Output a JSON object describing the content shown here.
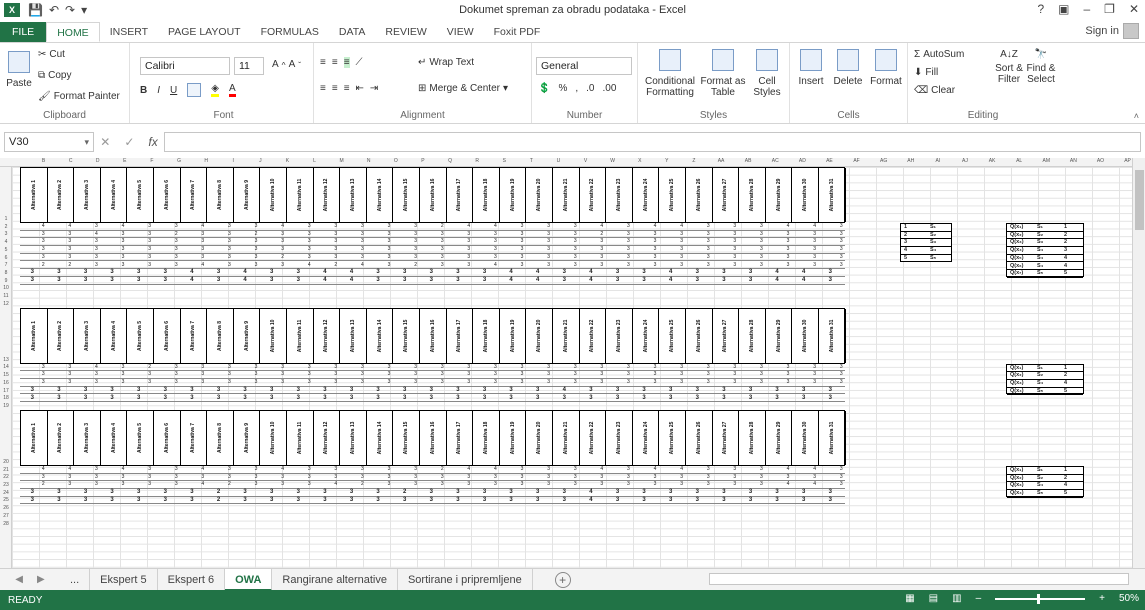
{
  "app": {
    "title": "Dokumet spreman za obradu podataka - Excel",
    "logo": "X",
    "help": "?",
    "sign_in": "Sign in",
    "brand_color": "#217346"
  },
  "ribbon_tabs": [
    "FILE",
    "HOME",
    "INSERT",
    "PAGE LAYOUT",
    "FORMULAS",
    "DATA",
    "REVIEW",
    "VIEW",
    "Foxit PDF"
  ],
  "active_tab": "HOME",
  "ribbon": {
    "clipboard": {
      "paste": "Paste",
      "cut": "Cut",
      "copy": "Copy",
      "format_painter": "Format Painter",
      "label": "Clipboard"
    },
    "font": {
      "family": "Calibri",
      "size": "11",
      "bold": "B",
      "italic": "I",
      "underline": "U",
      "label": "Font"
    },
    "alignment": {
      "wrap": "Wrap Text",
      "merge": "Merge & Center",
      "label": "Alignment"
    },
    "number": {
      "format": "General",
      "percent": "%",
      "comma": ",",
      "label": "Number"
    },
    "styles": {
      "conditional": "Conditional Formatting",
      "format_as": "Format as Table",
      "cell_styles": "Cell Styles",
      "label": "Styles"
    },
    "cells": {
      "insert": "Insert",
      "delete": "Delete",
      "format": "Format",
      "label": "Cells"
    },
    "editing": {
      "autosum": "AutoSum",
      "fill": "Fill",
      "clear": "Clear",
      "sort": "Sort & Filter",
      "find": "Find & Select",
      "label": "Editing"
    }
  },
  "formula_bar": {
    "name_box": "V30",
    "fx": "fx",
    "value": ""
  },
  "column_headers": [
    "B",
    "C",
    "D",
    "E",
    "F",
    "G",
    "H",
    "I",
    "J",
    "K",
    "L",
    "M",
    "N",
    "O",
    "P",
    "Q",
    "R",
    "S",
    "T",
    "U",
    "V",
    "W",
    "X",
    "Y",
    "Z",
    "AA",
    "AB",
    "AC",
    "AD",
    "AE",
    "AF",
    "AG",
    "AH",
    "AI",
    "AJ",
    "AK",
    "AL",
    "AM",
    "AN",
    "AO",
    "AP",
    "AQ"
  ],
  "row_headers": [
    "1",
    "2",
    "3",
    "4",
    "5",
    "6",
    "7",
    "8",
    "9",
    "10",
    "11",
    "12",
    "13",
    "14",
    "15",
    "16",
    "17",
    "18",
    "19",
    "20",
    "21",
    "22",
    "23",
    "24",
    "25",
    "26",
    "27",
    "28"
  ],
  "alternatives": [
    "Alternativa 1",
    "Alternativa 2",
    "Alternativa 3",
    "Alternativa 4",
    "Alternativa 5",
    "Alternativa 6",
    "Alternativa 7",
    "Alternativa 8",
    "Alternativa 9",
    "Alternativa 10",
    "Alternativa 11",
    "Alternativa 12",
    "Alternativa 13",
    "Alternativa 14",
    "Alternativa 15",
    "Alternativa 16",
    "Alternativa 17",
    "Alternativa 18",
    "Alternativa 19",
    "Alternativa 20",
    "Alternativa 21",
    "Alternativa 22",
    "Alternativa 23",
    "Alternativa 24",
    "Alternativa 25",
    "Alternativa 26",
    "Alternativa 27",
    "Alternativa 28",
    "Alternativa 29",
    "Alternativa 30",
    "Alternativa 31"
  ],
  "block1": {
    "rows": [
      [
        "4",
        "4",
        "3",
        "4",
        "3",
        "3",
        "4",
        "3",
        "3",
        "4",
        "3",
        "3",
        "3",
        "3",
        "3",
        "2",
        "4",
        "4",
        "3",
        "3",
        "3",
        "4",
        "3",
        "4",
        "4",
        "3",
        "3",
        "3",
        "4",
        "4",
        "3"
      ],
      [
        "3",
        "3",
        "4",
        "3",
        "3",
        "2",
        "3",
        "3",
        "2",
        "3",
        "3",
        "3",
        "3",
        "3",
        "3",
        "3",
        "3",
        "3",
        "3",
        "3",
        "3",
        "2",
        "3",
        "3",
        "3",
        "3",
        "3",
        "3",
        "3",
        "3",
        "3"
      ],
      [
        "3",
        "3",
        "3",
        "3",
        "3",
        "3",
        "3",
        "3",
        "3",
        "3",
        "3",
        "3",
        "3",
        "3",
        "3",
        "3",
        "3",
        "3",
        "3",
        "3",
        "3",
        "3",
        "3",
        "3",
        "3",
        "3",
        "3",
        "3",
        "3",
        "3",
        "3"
      ],
      [
        "3",
        "3",
        "3",
        "3",
        "3",
        "3",
        "3",
        "3",
        "3",
        "3",
        "3",
        "3",
        "3",
        "3",
        "3",
        "3",
        "3",
        "3",
        "3",
        "3",
        "3",
        "3",
        "3",
        "3",
        "3",
        "3",
        "3",
        "3",
        "3",
        "3",
        "3"
      ],
      [
        "3",
        "3",
        "3",
        "3",
        "3",
        "3",
        "3",
        "3",
        "3",
        "2",
        "3",
        "3",
        "3",
        "3",
        "3",
        "3",
        "3",
        "3",
        "3",
        "3",
        "3",
        "3",
        "3",
        "3",
        "3",
        "3",
        "3",
        "3",
        "3",
        "3",
        "3"
      ],
      [
        "2",
        "2",
        "3",
        "3",
        "3",
        "3",
        "4",
        "3",
        "3",
        "3",
        "4",
        "2",
        "4",
        "3",
        "2",
        "3",
        "3",
        "4",
        "3",
        "3",
        "3",
        "3",
        "3",
        "3",
        "3",
        "3",
        "3",
        "3",
        "3",
        "3",
        "3"
      ]
    ],
    "total_row_1": [
      "3",
      "3",
      "3",
      "3",
      "3",
      "3",
      "4",
      "3",
      "4",
      "3",
      "3",
      "4",
      "4",
      "3",
      "3",
      "3",
      "3",
      "3",
      "4",
      "4",
      "3",
      "4",
      "3",
      "3",
      "4",
      "3",
      "3",
      "3",
      "4",
      "4",
      "3"
    ],
    "total_row_2": [
      "3",
      "3",
      "3",
      "3",
      "3",
      "3",
      "4",
      "3",
      "4",
      "3",
      "3",
      "4",
      "4",
      "3",
      "3",
      "3",
      "3",
      "3",
      "4",
      "4",
      "3",
      "4",
      "3",
      "3",
      "4",
      "3",
      "3",
      "3",
      "4",
      "4",
      "3"
    ]
  },
  "block2": {
    "rows": [
      [
        "3",
        "3",
        "4",
        "3",
        "2",
        "3",
        "3",
        "3",
        "3",
        "3",
        "3",
        "3",
        "3",
        "3",
        "3",
        "3",
        "3",
        "3",
        "3",
        "3",
        "3",
        "3",
        "3",
        "3",
        "3",
        "3",
        "3",
        "3",
        "3",
        "3",
        "3"
      ],
      [
        "3",
        "3",
        "3",
        "3",
        "3",
        "3",
        "3",
        "3",
        "3",
        "3",
        "3",
        "3",
        "3",
        "3",
        "3",
        "3",
        "3",
        "3",
        "3",
        "3",
        "3",
        "3",
        "3",
        "3",
        "3",
        "3",
        "3",
        "3",
        "3",
        "3",
        "3"
      ],
      [
        "3",
        "3",
        "3",
        "3",
        "3",
        "3",
        "3",
        "3",
        "3",
        "3",
        "3",
        "3",
        "3",
        "3",
        "3",
        "3",
        "3",
        "3",
        "3",
        "3",
        "3",
        "3",
        "3",
        "3",
        "3",
        "3",
        "3",
        "3",
        "3",
        "3",
        "3"
      ]
    ],
    "total_row_1": [
      "3",
      "3",
      "3",
      "3",
      "3",
      "3",
      "3",
      "3",
      "3",
      "3",
      "3",
      "3",
      "3",
      "3",
      "3",
      "3",
      "3",
      "3",
      "3",
      "3",
      "4",
      "3",
      "3",
      "3",
      "3",
      "3",
      "3",
      "3",
      "3",
      "3",
      "3"
    ],
    "total_row_2": [
      "3",
      "3",
      "3",
      "3",
      "3",
      "3",
      "3",
      "3",
      "3",
      "3",
      "3",
      "3",
      "3",
      "3",
      "3",
      "3",
      "3",
      "3",
      "3",
      "3",
      "3",
      "3",
      "3",
      "3",
      "3",
      "3",
      "3",
      "3",
      "3",
      "3",
      "3"
    ]
  },
  "block3": {
    "rows": [
      [
        "4",
        "4",
        "3",
        "4",
        "3",
        "3",
        "4",
        "3",
        "3",
        "4",
        "3",
        "3",
        "3",
        "3",
        "3",
        "2",
        "4",
        "4",
        "3",
        "3",
        "3",
        "4",
        "3",
        "4",
        "4",
        "3",
        "3",
        "3",
        "4",
        "4",
        "3"
      ],
      [
        "3",
        "3",
        "3",
        "3",
        "3",
        "3",
        "3",
        "3",
        "3",
        "3",
        "3",
        "3",
        "3",
        "3",
        "3",
        "3",
        "3",
        "3",
        "3",
        "3",
        "3",
        "3",
        "3",
        "3",
        "3",
        "3",
        "3",
        "3",
        "3",
        "3",
        "3"
      ],
      [
        "2",
        "3",
        "3",
        "3",
        "3",
        "3",
        "4",
        "2",
        "3",
        "3",
        "3",
        "4",
        "2",
        "3",
        "3",
        "3",
        "3",
        "3",
        "3",
        "3",
        "3",
        "3",
        "3",
        "3",
        "3",
        "3",
        "3",
        "3",
        "4",
        "4",
        "3"
      ]
    ],
    "total_row_1": [
      "3",
      "3",
      "3",
      "3",
      "3",
      "3",
      "3",
      "2",
      "3",
      "3",
      "3",
      "3",
      "3",
      "3",
      "2",
      "3",
      "3",
      "3",
      "3",
      "3",
      "3",
      "4",
      "3",
      "3",
      "3",
      "3",
      "3",
      "3",
      "3",
      "3",
      "3"
    ],
    "total_row_2": [
      "3",
      "3",
      "3",
      "3",
      "3",
      "3",
      "3",
      "2",
      "3",
      "3",
      "3",
      "3",
      "3",
      "3",
      "3",
      "3",
      "3",
      "3",
      "3",
      "3",
      "3",
      "4",
      "3",
      "3",
      "3",
      "3",
      "3",
      "3",
      "3",
      "3",
      "3"
    ]
  },
  "side_table_1": [
    [
      "1",
      "S₁"
    ],
    [
      "2",
      "S₂"
    ],
    [
      "3",
      "S₃"
    ],
    [
      "4",
      "S₄"
    ],
    [
      "5",
      "S₅"
    ]
  ],
  "q_table_1": [
    [
      "Q(x₁)",
      "S₁",
      "1"
    ],
    [
      "Q(x₂)",
      "S₂",
      "2"
    ],
    [
      "Q(x₃)",
      "S₃",
      "2"
    ],
    [
      "Q(x₄)",
      "S₄",
      "3"
    ],
    [
      "Q(x₅)",
      "S₄",
      "4"
    ],
    [
      "Q(x₆)",
      "S₄",
      "4"
    ],
    [
      "Q(x₇)",
      "S₅",
      "5"
    ]
  ],
  "q_table_2": [
    [
      "Q(x₁)",
      "S₁",
      "1"
    ],
    [
      "Q(x₂)",
      "S₂",
      "2"
    ],
    [
      "Q(x₃)",
      "S₄",
      "4"
    ],
    [
      "Q(x₄)",
      "S₅",
      "5"
    ]
  ],
  "q_table_3": [
    [
      "Q(x₁)",
      "S₁",
      "1"
    ],
    [
      "Q(x₂)",
      "S₂",
      "2"
    ],
    [
      "Q(x₃)",
      "S₄",
      "4"
    ],
    [
      "Q(x₄)",
      "S₅",
      "5"
    ]
  ],
  "sheet_tabs": [
    "...",
    "Ekspert 5",
    "Ekspert 6",
    "OWA",
    "Rangirane alternative",
    "Sortirane i pripremljene"
  ],
  "active_sheet": "OWA",
  "status": {
    "mode": "READY",
    "zoom": "50%"
  }
}
